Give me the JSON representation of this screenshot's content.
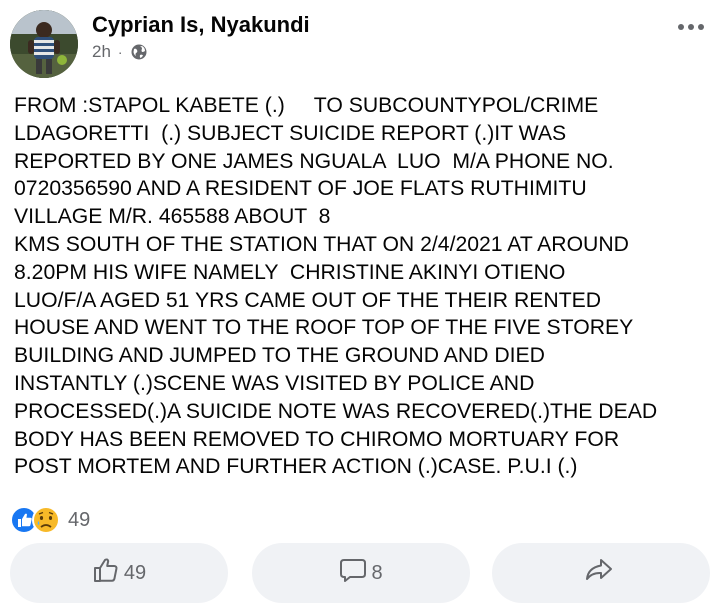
{
  "header": {
    "author_name": "Cyprian Is, Nyakundi",
    "timestamp": "2h",
    "separator": "·",
    "audience_icon": "globe-icon",
    "more_icon": "more-options-icon"
  },
  "post": {
    "text": "FROM :STAPOL KABETE (.)     TO SUBCOUNTYPOL/CRIME\nLDAGORETTI  (.) SUBJECT SUICIDE REPORT (.)IT WAS\nREPORTED BY ONE JAMES NGUALA  LUO  M/A PHONE NO.\n0720356590 AND A RESIDENT OF JOE FLATS RUTHIMITU\nVILLAGE M/R. 465588 ABOUT  8\nKMS SOUTH OF THE STATION THAT ON 2/4/2021 AT AROUND\n8.20PM HIS WIFE NAMELY  CHRISTINE AKINYI OTIENO\nLUO/F/A AGED 51 YRS CAME OUT OF THE THEIR RENTED\nHOUSE AND WENT TO THE ROOF TOP OF THE FIVE STOREY\nBUILDING AND JUMPED TO THE GROUND AND DIED\nINSTANTLY (.)SCENE WAS VISITED BY POLICE AND\nPROCESSED(.)A SUICIDE NOTE WAS RECOVERED(.)THE DEAD\nBODY HAS BEEN REMOVED TO CHIROMO MORTUARY FOR\nPOST MORTEM AND FURTHER ACTION (.)CASE. P.U.I (.)"
  },
  "reactions": {
    "count": "49",
    "icons": [
      "like-reaction-icon",
      "sad-reaction-icon"
    ]
  },
  "actions": {
    "like_count": "49",
    "comment_count": "8",
    "like_icon": "thumbs-up-icon",
    "comment_icon": "comment-bubble-icon",
    "share_icon": "share-arrow-icon"
  },
  "colors": {
    "text": "#050505",
    "secondary_text": "#65676b",
    "button_bg": "#f0f2f5",
    "like_blue": "#1877f2",
    "sad_yellow": "#f7b928"
  }
}
